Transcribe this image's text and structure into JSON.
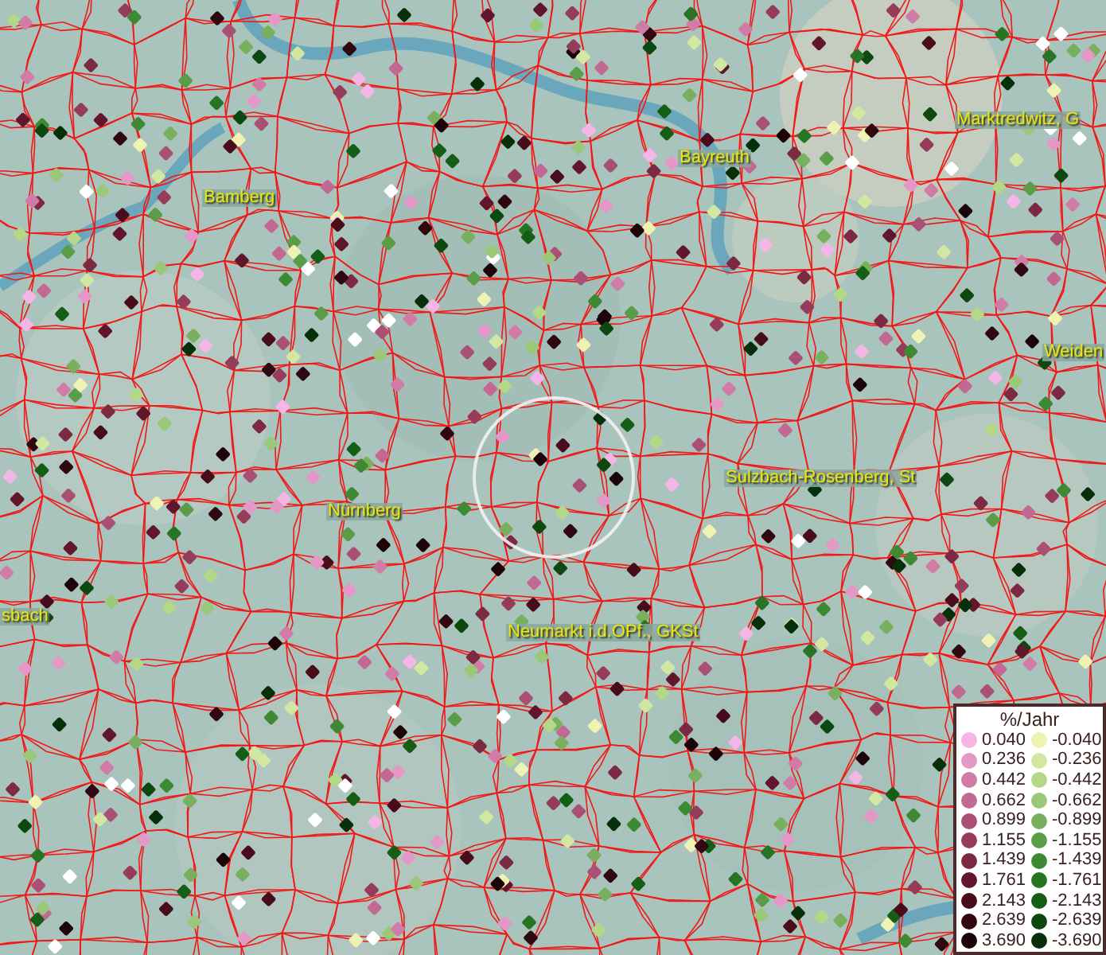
{
  "map": {
    "places": [
      {
        "name": "Bamberg"
      },
      {
        "name": "Bayreuth"
      },
      {
        "name": "Marktredwitz, G"
      },
      {
        "name": "Weiden"
      },
      {
        "name": "Sulzbach-Rosenberg, St"
      },
      {
        "name": "Nürnberg"
      },
      {
        "name": "Neumarkt i.d.OPf., GKSt"
      },
      {
        "name": "sbach"
      }
    ]
  },
  "legend": {
    "title": "%/Jahr",
    "positive": [
      {
        "label": "0.040",
        "color": "#f4b6e6"
      },
      {
        "label": "0.236",
        "color": "#e498c8"
      },
      {
        "label": "0.442",
        "color": "#d07ca6"
      },
      {
        "label": "0.662",
        "color": "#c26892"
      },
      {
        "label": "0.899",
        "color": "#aa5074"
      },
      {
        "label": "1.155",
        "color": "#943c5a"
      },
      {
        "label": "1.439",
        "color": "#7c2a42"
      },
      {
        "label": "1.761",
        "color": "#62162c"
      },
      {
        "label": "2.143",
        "color": "#480c1a"
      },
      {
        "label": "2.639",
        "color": "#300810"
      },
      {
        "label": "3.690",
        "color": "#1c0408"
      }
    ],
    "negative": [
      {
        "label": "-0.040",
        "color": "#eef2b2"
      },
      {
        "label": "-0.236",
        "color": "#d2e8a2"
      },
      {
        "label": "-0.442",
        "color": "#b2d888"
      },
      {
        "label": "-0.662",
        "color": "#98c878"
      },
      {
        "label": "-0.899",
        "color": "#78b060"
      },
      {
        "label": "-1.155",
        "color": "#5a9c48"
      },
      {
        "label": "-1.439",
        "color": "#3e8a34"
      },
      {
        "label": "-1.761",
        "color": "#267424"
      },
      {
        "label": "-2.143",
        "color": "#145e16"
      },
      {
        "label": "-2.639",
        "color": "#0c4810"
      },
      {
        "label": "-3.690",
        "color": "#06300a"
      }
    ]
  }
}
